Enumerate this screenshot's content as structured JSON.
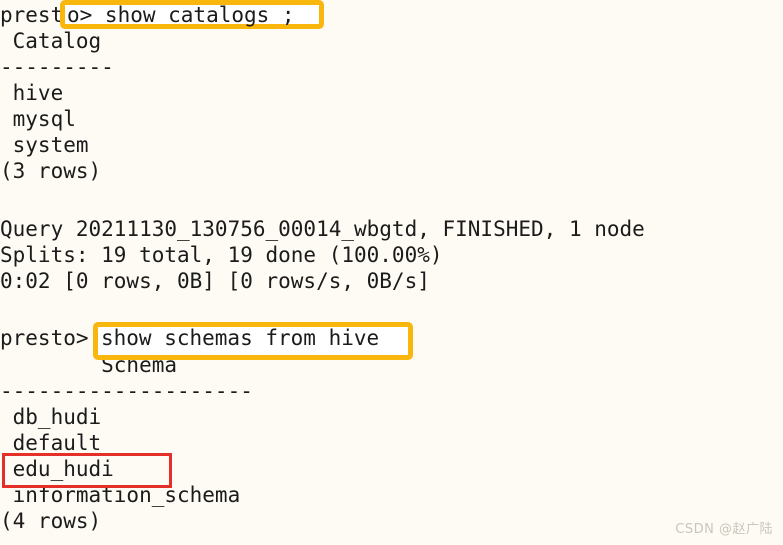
{
  "terminal": {
    "background_color": "#fdfbf3",
    "text_color": "#1b1b1b",
    "highlight_color": "#f9b60d",
    "redbox_color": "#e5302a",
    "lines": [
      {
        "id": "prompt1",
        "text": "presto> show catalogs ;"
      },
      {
        "id": "catalog_header",
        "text": " Catalog"
      },
      {
        "id": "catalog_rule",
        "text": "---------"
      },
      {
        "id": "catalog_row_1",
        "text": " hive"
      },
      {
        "id": "catalog_row_2",
        "text": " mysql"
      },
      {
        "id": "catalog_row_3",
        "text": " system"
      },
      {
        "id": "catalog_count",
        "text": "(3 rows)"
      },
      {
        "id": "query_status",
        "text": "Query 20211130_130756_00014_wbgtd, FINISHED, 1 node"
      },
      {
        "id": "splits_status",
        "text": "Splits: 19 total, 19 done (100.00%)"
      },
      {
        "id": "timing_status",
        "text": "0:02 [0 rows, 0B] [0 rows/s, 0B/s]"
      },
      {
        "id": "prompt2",
        "text": "presto> show schemas from hive ;"
      },
      {
        "id": "schema_header",
        "text": "        Schema"
      },
      {
        "id": "schema_rule",
        "text": "--------------------"
      },
      {
        "id": "schema_row_1",
        "text": " db_hudi"
      },
      {
        "id": "schema_row_2",
        "text": " default"
      },
      {
        "id": "schema_row_3",
        "text": " edu_hudi"
      },
      {
        "id": "schema_row_4",
        "text": " information_schema"
      },
      {
        "id": "schema_count",
        "text": "(4 rows)"
      }
    ],
    "prompt_prefix": "presto>",
    "commands": {
      "first": "show catalogs ;",
      "second": "show schemas from hive "
    },
    "highlight_1_text": "o> show catalogs ;",
    "highlight_2_text": "show schemas from hive ",
    "redbox_target": "edu_hudi",
    "trailing_semicolon": ";"
  },
  "watermark": {
    "text": "CSDN @赵广陆"
  }
}
